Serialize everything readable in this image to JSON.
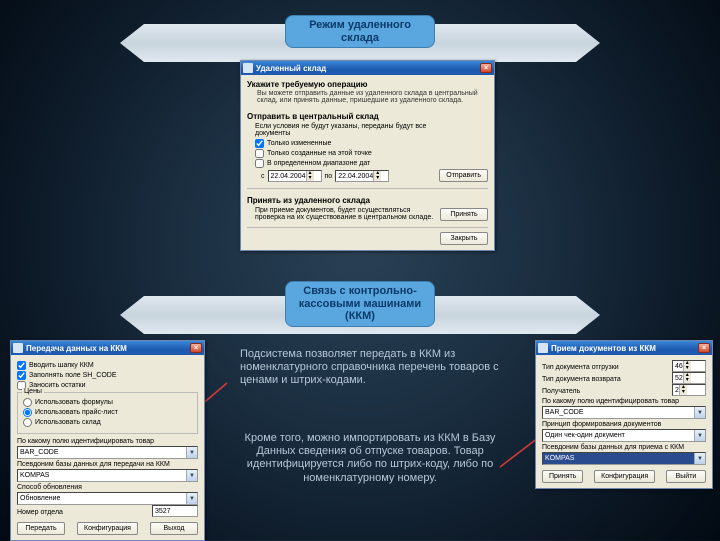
{
  "banners": {
    "top": "Режим удаленного склада",
    "mid": "Связь с контрольно-кассовыми машинами (ККМ)"
  },
  "remote": {
    "title": "Удаленный склад",
    "h1": "Укажите требуемую операцию",
    "sub": "Вы можете отправить данные из удаленного склада в центральный склад, или принять данные, пришедшие из удаленного склада.",
    "send_title": "Отправить в центральный склад",
    "send_sub": "Если условия не будут указаны, переданы будут все документы",
    "cb1": "Только измененные",
    "cb2": "Только созданные на этой точке",
    "cb3": "В определенном диапазоне дат",
    "from_lbl": "с",
    "to_lbl": "по",
    "date_from": "22.04.2004",
    "date_to": "22.04.2004",
    "btn_send": "Отправить",
    "recv_title": "Принять из удаленного склада",
    "recv_sub": "При приеме документов, будет осуществляться проверка на их существование в центральном складе.",
    "btn_recv": "Принять",
    "btn_close": "Закрыть"
  },
  "send_kkm": {
    "title": "Передача данных на ККМ",
    "cb1": "Вводить шапку ККМ",
    "cb2": "Заполнять поле SH_CODE",
    "cb3": "Заносить остатки",
    "grp": "Цены",
    "r1": "Использовать формулы",
    "r2": "Использовать прайс-лист",
    "r3": "Использовать склад",
    "lbl_ident": "По какому полю идентифицировать товар",
    "ident": "BAR_CODE",
    "lbl_pseudo": "Псевдоним базы данных для передачи на ККМ",
    "pseudo": "KOMPAS",
    "lbl_upd": "Способ обновления",
    "upd": "Обновление",
    "lbl_dept": "Номер отдела",
    "dept": "3527",
    "btn_send": "Передать",
    "btn_cfg": "Конфигурация",
    "btn_exit": "Выход"
  },
  "recv_kkm": {
    "title": "Прием документов из ККМ",
    "lbl_ship": "Тип документа отгрузки",
    "ship": "46",
    "lbl_ret": "Тип документа возврата",
    "ret": "52",
    "lbl_recv": "Получатель",
    "recv": "2",
    "lbl_ident": "По какому полю идентифицировать товар",
    "ident": "BAR_CODE",
    "lbl_princ": "Принцип формирования документов",
    "princ": "Один чек-один документ",
    "lbl_pseudo": "Псевдоним базы данных для приема с ККМ",
    "pseudo": "KOMPAS",
    "btn_recv": "Принять",
    "btn_cfg": "Конфигурация",
    "btn_exit": "Выйти"
  },
  "desc1": "Подсистема позволяет передать в ККМ из номенклатурного справочника перечень товаров с ценами и штрих-кодами.",
  "desc2": "Кроме того, можно импортировать из ККМ в Базу Данных сведения об отпуске товаров. Товар идентифицируется либо по штрих-коду, либо по номенклатурному номеру."
}
